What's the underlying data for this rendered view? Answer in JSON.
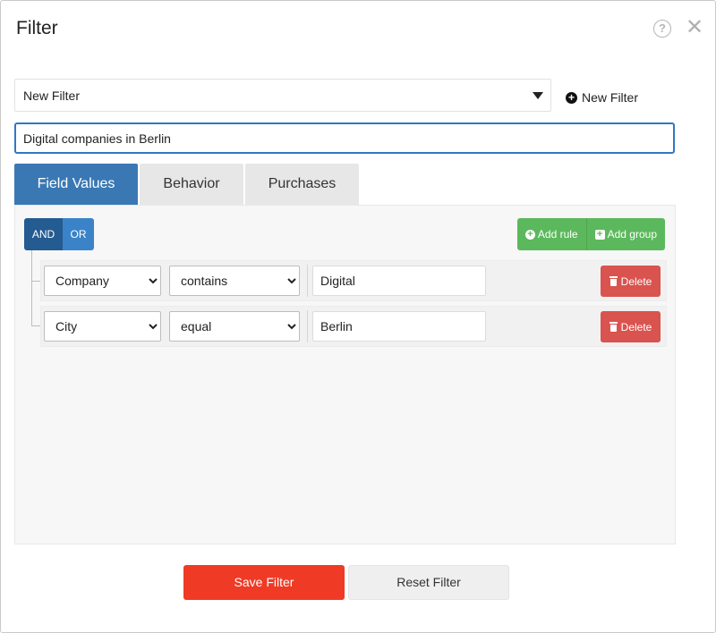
{
  "dialog": {
    "title": "Filter",
    "help_icon": "question-circle-icon",
    "close_icon": "close-icon",
    "close_glyph": "✕",
    "help_glyph": "?"
  },
  "filter_select": {
    "selected": "New Filter"
  },
  "new_filter_link": {
    "label": "New Filter",
    "icon": "plus-circle-icon",
    "glyph": "+"
  },
  "name_input": {
    "value": "Digital companies in Berlin"
  },
  "tabs": [
    {
      "label": "Field Values",
      "active": true
    },
    {
      "label": "Behavior",
      "active": false
    },
    {
      "label": "Purchases",
      "active": false
    }
  ],
  "group": {
    "conjunctions": {
      "and": "AND",
      "or": "OR",
      "selected": "AND"
    },
    "add_rule_label": "Add rule",
    "add_group_label": "Add group",
    "plus_glyph": "+"
  },
  "rules": [
    {
      "field": "Company",
      "operator": "contains",
      "value": "Digital",
      "delete_label": "Delete"
    },
    {
      "field": "City",
      "operator": "equal",
      "value": "Berlin",
      "delete_label": "Delete"
    }
  ],
  "footer": {
    "save_label": "Save Filter",
    "reset_label": "Reset Filter"
  },
  "colors": {
    "active_tab": "#3a78b3",
    "and_button": "#245b91",
    "or_button": "#3a83c8",
    "green": "#5cb85c",
    "delete_red": "#d9534f",
    "save_red": "#ef3a25",
    "input_focus_border": "#2f78c4"
  }
}
